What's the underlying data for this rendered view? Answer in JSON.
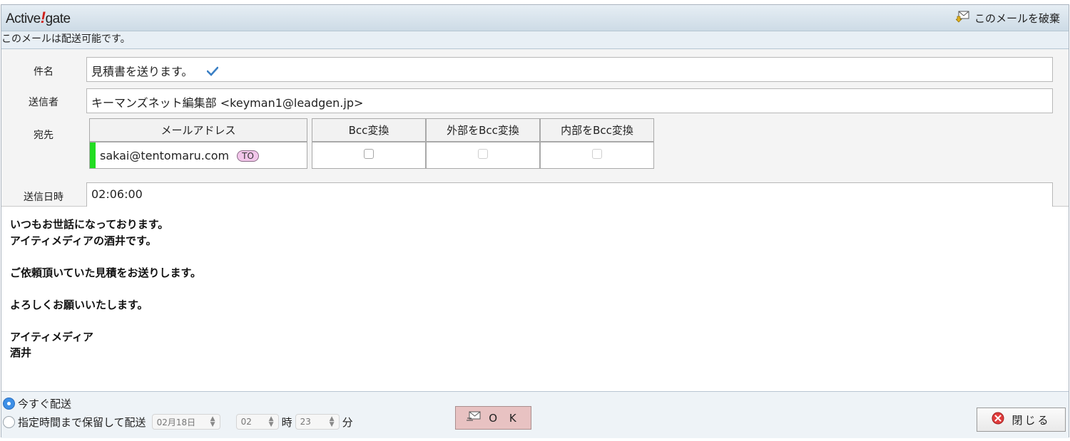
{
  "header": {
    "logo_text_left": "Active",
    "logo_bang": "!",
    "logo_text_right": "gate",
    "discard_label": "このメールを破棄"
  },
  "status_message": "このメールは配送可能です。",
  "fields": {
    "subject_label": "件名",
    "subject_value": "見積書を送ります。",
    "sender_label": "送信者",
    "sender_value": "キーマンズネット編集部 <keyman1@leadgen.jp>",
    "recipient_label": "宛先",
    "sent_time_label": "送信日時",
    "sent_time_value": "02:06:00"
  },
  "recipient_table": {
    "headers": [
      "メールアドレス",
      "Bcc変換",
      "外部をBcc変換",
      "内部をBcc変換"
    ],
    "rows": [
      {
        "address": "sakai@tentomaru.com",
        "badge": "TO"
      }
    ]
  },
  "body_lines": [
    "いつもお世話になっております。",
    "アイティメディアの酒井です。",
    "",
    "ご依頼頂いていた見積をお送りします。",
    "",
    "よろしくお願いいたします。",
    "",
    "アイティメディア",
    "酒井"
  ],
  "footer": {
    "send_now_label": "今すぐ配送",
    "send_later_label": "指定時間まで保留して配送",
    "date_value": "02月18日",
    "hour_value": "02",
    "hour_unit": "時",
    "minute_value": "23",
    "minute_unit": "分",
    "ok_label": "O K",
    "close_label": "閉じる"
  },
  "colors": {
    "accent_green": "#22dd22",
    "ok_button": "#e8c2c2",
    "to_badge": "#f2c6ea",
    "header_bg": "#cddbe6"
  },
  "icons": {
    "discard": "mail-discard-icon",
    "subject_check": "checkmark-icon",
    "ok": "mail-send-icon",
    "close": "close-circle-icon"
  }
}
